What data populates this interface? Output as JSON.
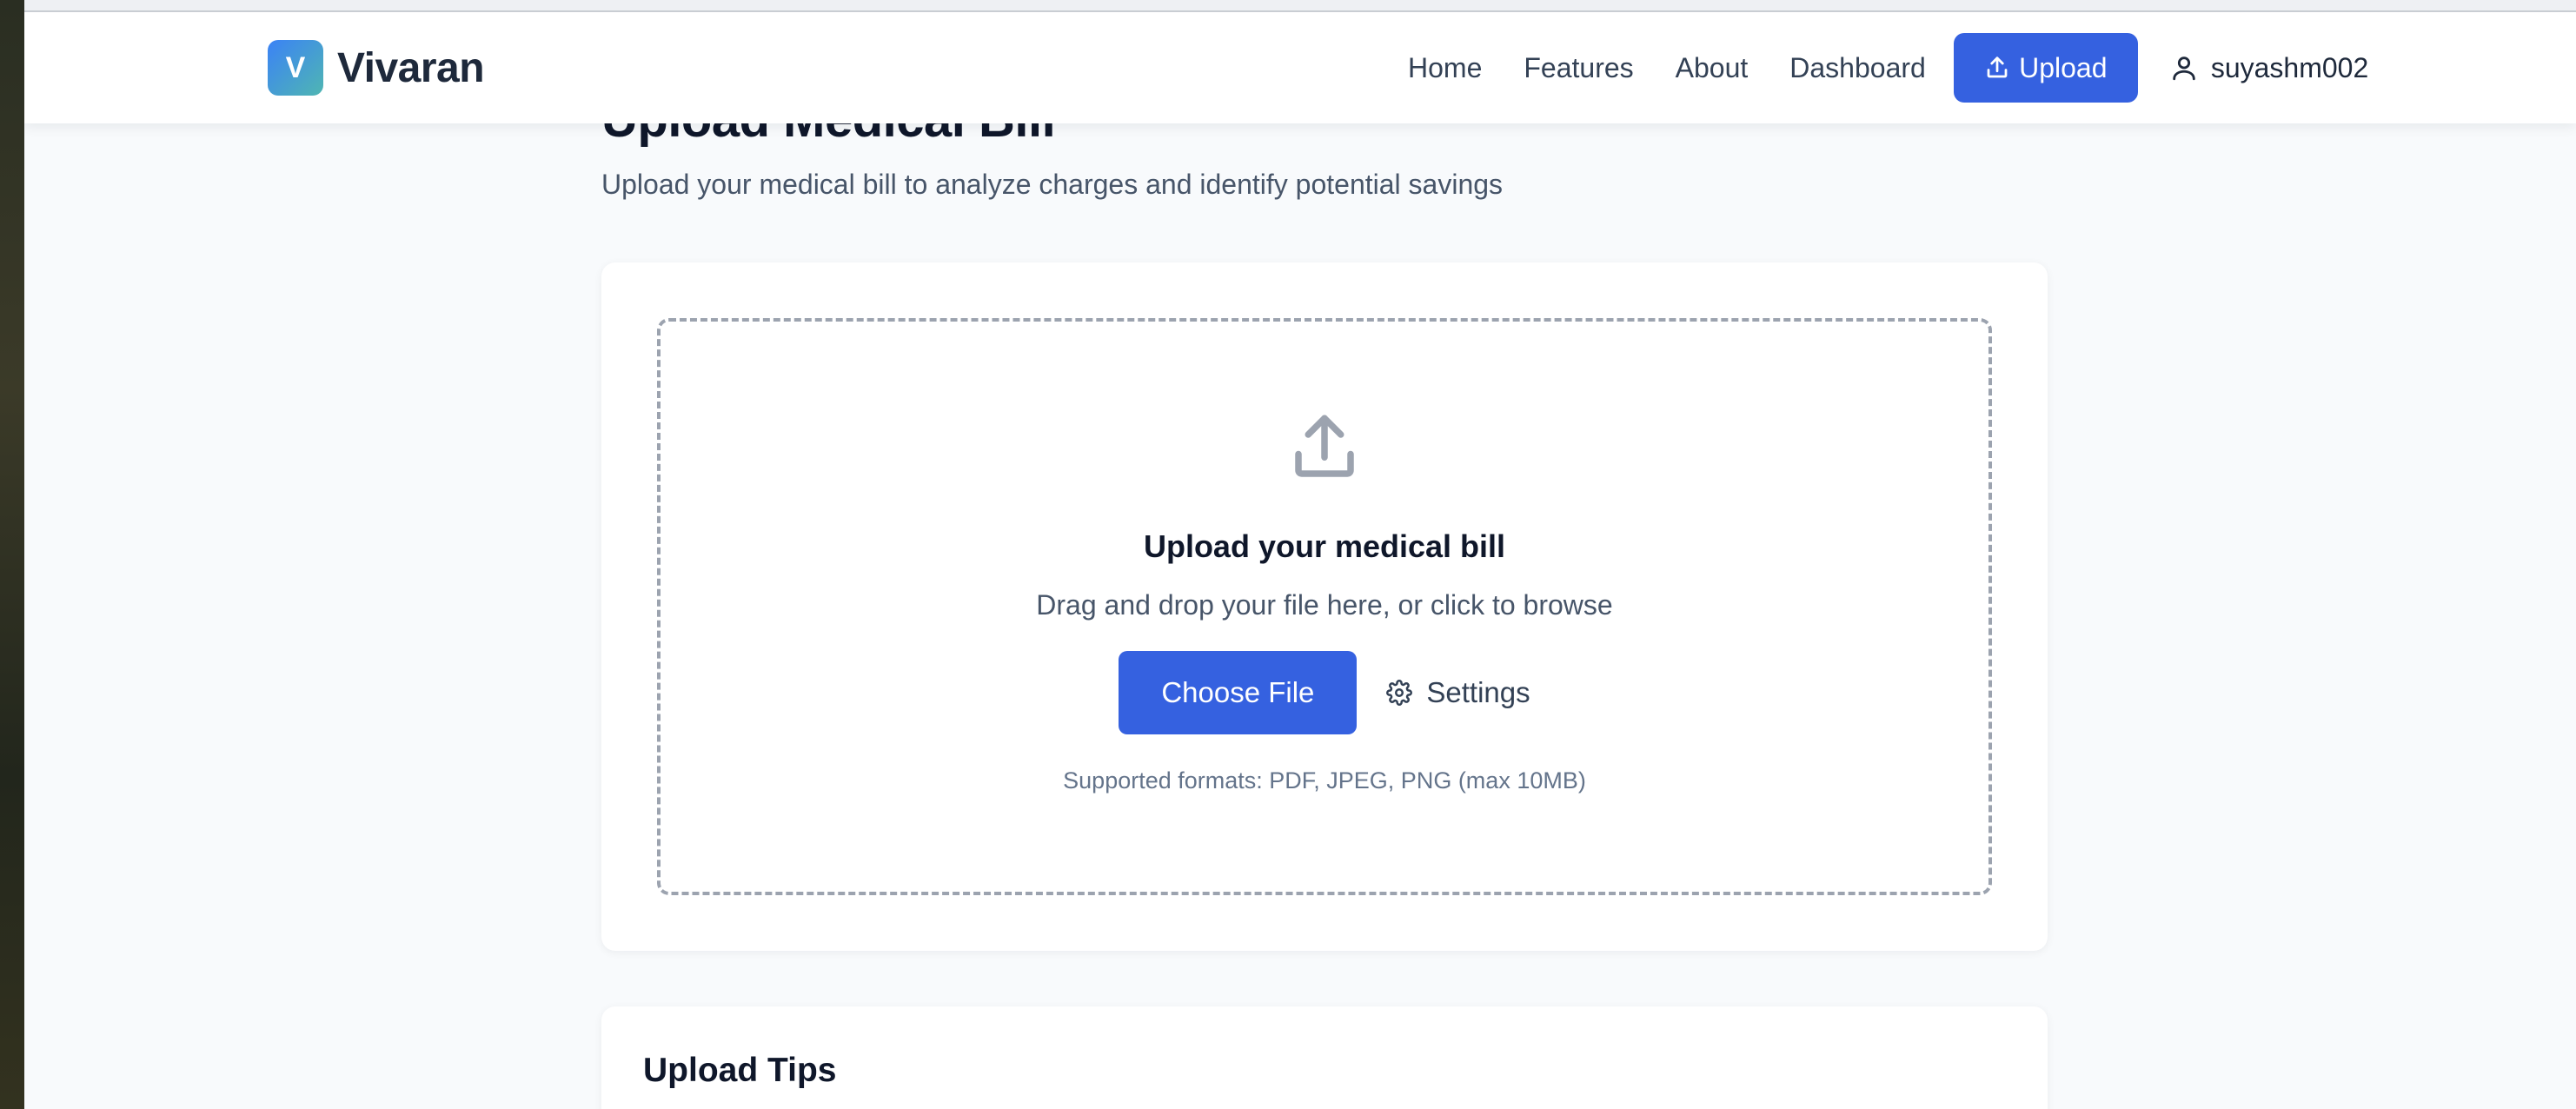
{
  "header": {
    "brand_letter": "V",
    "brand_name": "Vivaran",
    "nav": [
      "Home",
      "Features",
      "About",
      "Dashboard"
    ],
    "upload_label": "Upload",
    "username": "suyashm002"
  },
  "main": {
    "title": "Upload Medical Bill",
    "subtitle": "Upload your medical bill to analyze charges and identify potential savings",
    "dropzone": {
      "icon": "upload-tray-icon",
      "title": "Upload your medical bill",
      "subtitle": "Drag and drop your file here, or click to browse",
      "choose_label": "Choose File",
      "settings_label": "Settings",
      "formats": "Supported formats: PDF, JPEG, PNG (max 10MB)"
    },
    "tips_title": "Upload Tips"
  },
  "colors": {
    "primary": "#3561e0",
    "brand_gradient_start": "#3b82f6",
    "brand_gradient_end": "#4fb6b2",
    "page_bg": "#f8fafc"
  }
}
